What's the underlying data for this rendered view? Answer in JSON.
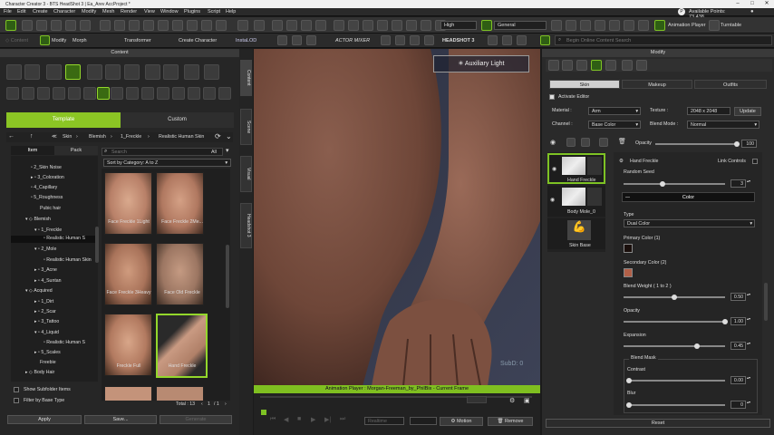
{
  "titlebar": {
    "title": "Character Creator 3 - BTS HeadShot 3 | Ea_Arev AccProject *"
  },
  "menu": {
    "items": [
      "File",
      "Edit",
      "Create",
      "Character",
      "Modify",
      "Mesh",
      "Render",
      "View",
      "Window",
      "Plugins",
      "Script",
      "Help"
    ],
    "points": "Available Points: 73,438"
  },
  "toolbar": {
    "quality": "High",
    "mode": "General",
    "anim_player": "Animation Player",
    "turntable": "Turntable"
  },
  "toolbar2": {
    "modify": "Modify",
    "morph": "Morph",
    "transformer": "Transformer",
    "create_char": "Create Character",
    "instalod": "InstaLOD",
    "actormixer": "ACTOR MIXER",
    "headshot": "HEADSHOT 3",
    "search_placeholder": "Begin Online Content Search"
  },
  "content": {
    "title": "Content",
    "tab_template": "Template",
    "tab_custom": "Custom",
    "breadcrumb": [
      "Skin",
      "Blemish",
      "1_Freckle",
      "Realistic Human Skin"
    ],
    "sub_item": "Item",
    "sub_pack": "Pack",
    "search_placeholder": "Search",
    "filter_all": "All",
    "sort": "Sort by Category: A to Z",
    "tree": [
      "2_Skin Noise",
      "3_Coloration",
      "4_Capillary",
      "5_Roughness",
      "Pubic hair",
      "Blemish",
      "1_Freckle",
      "Realistic Human S",
      "2_Mole",
      "Realistic Human Skin",
      "3_Acne",
      "4_Suntan",
      "Acquired",
      "1_Dirt",
      "2_Scar",
      "3_Tattoo",
      "4_Liquid",
      "Realistic Human S",
      "5_Scales",
      "Freebie",
      "Body Hair"
    ],
    "thumbs": [
      "Face Freckle 1Light",
      "Face Freckle 2Me...",
      "Face Freckle 3Heavy",
      "Face Old Freckle",
      "Freckle Full",
      "Hand Freckle"
    ],
    "show_subfolder": "Show Subfolder Items",
    "filter_base": "Filter by Base Type",
    "total": "Total : 13",
    "page": "1",
    "pages": "/ 1",
    "apply": "Apply",
    "save": "Save...",
    "generate": "Generate"
  },
  "vtabs": [
    "Content",
    "Scene",
    "Visual",
    "Headshot 3"
  ],
  "viewport": {
    "aux_light": "Auxiliary Light",
    "subd": "SubD: 0"
  },
  "anim": {
    "title": "Animation Player : Morgan-Freeman_by_PhilBix - Current Frame",
    "realtime": "Realtime",
    "motion": "Motion",
    "remove": "Remove"
  },
  "modify": {
    "title": "Modify",
    "tabs": [
      "Skin",
      "Makeup",
      "Outfits"
    ],
    "activate_editor": "Activate Editor",
    "material_lbl": "Material :",
    "material": "Arm",
    "texture_lbl": "Texture :",
    "texture": "2048 x 2048",
    "update": "Update",
    "channel_lbl": "Channel :",
    "channel": "Base Color",
    "blend_lbl": "Blend Mode :",
    "blend": "Normal",
    "opacity_lbl": "Opacity",
    "opacity_val": "100",
    "layers": [
      "Hand Freckle",
      "Body Mole_0",
      "Skin Base"
    ],
    "layer_title": "Hand Freckle",
    "link_controls": "Link Controls",
    "random_seed": "Random Seed",
    "random_seed_val": "3",
    "color_btn": "Color",
    "type_lbl": "Type",
    "type_val": "Dual Color",
    "primary": "Primary Color (1)",
    "secondary": "Secondary Color (2)",
    "primary_color": "#1a0f0c",
    "secondary_color": "#b26048",
    "blend_weight": "Blend Weight ( 1 to 2 )",
    "blend_weight_val": "0.50",
    "opacity2": "Opacity",
    "opacity2_val": "1.00",
    "expansion": "Expansion",
    "expansion_val": "0.45",
    "blend_mask": "Blend Mask",
    "contrast": "Contrast",
    "contrast_val": "0.00",
    "blur": "Blur",
    "blur_val": "0",
    "reset": "Reset"
  },
  "levels": {
    "opacity": 1.0,
    "random_seed": 0.38,
    "blend_weight": 0.5,
    "opacity2": 1.0,
    "expansion": 0.72,
    "contrast": 0.0,
    "blur": 0.0
  }
}
